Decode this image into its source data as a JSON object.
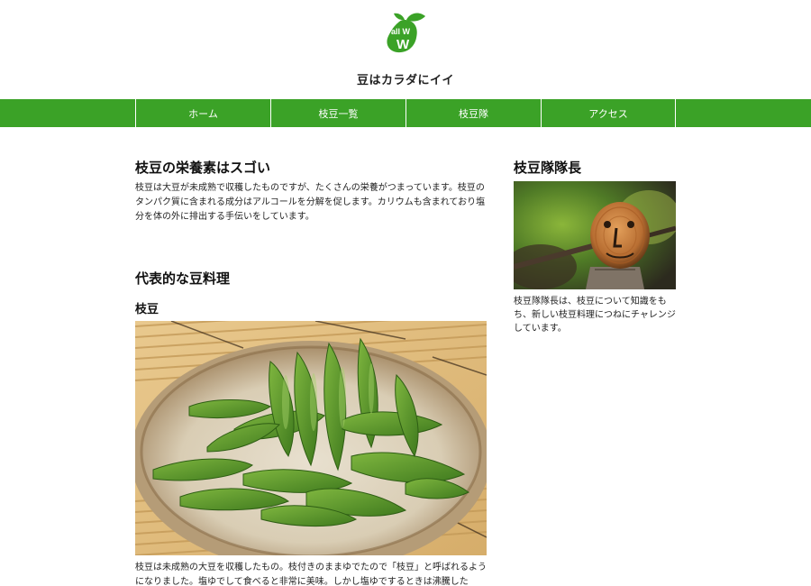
{
  "header": {
    "logo_text": "all W",
    "tagline": "豆はカラダにイイ"
  },
  "nav": {
    "items": [
      {
        "label": "ホーム"
      },
      {
        "label": "枝豆一覧"
      },
      {
        "label": "枝豆隊"
      },
      {
        "label": "アクセス"
      }
    ]
  },
  "main": {
    "section1": {
      "title": "枝豆の栄養素はスゴい",
      "body": "枝豆は大豆が未成熟で収穫したものですが、たくさんの栄養がつまっています。枝豆のタンパク質に含まれる成分はアルコールを分解を促します。カリウムも含まれており塩分を体の外に排出する手伝いをしています。"
    },
    "section2": {
      "title": "代表的な豆料理",
      "dish": {
        "name": "枝豆",
        "body": "枝豆は未成熟の大豆を収穫したもの。枝付きのままゆでたので「枝豆」と呼ばれるようになりました。塩ゆでして食べると非常に美味。しかし塩ゆでするときは沸騰した"
      }
    }
  },
  "sidebar": {
    "title": "枝豆隊隊長",
    "body": "枝豆隊隊長は、枝豆について知識をもち、新しい枝豆料理につねにチャレンジしています。"
  },
  "colors": {
    "brand_green": "#3ba227",
    "text": "#222222",
    "background": "#ffffff"
  }
}
